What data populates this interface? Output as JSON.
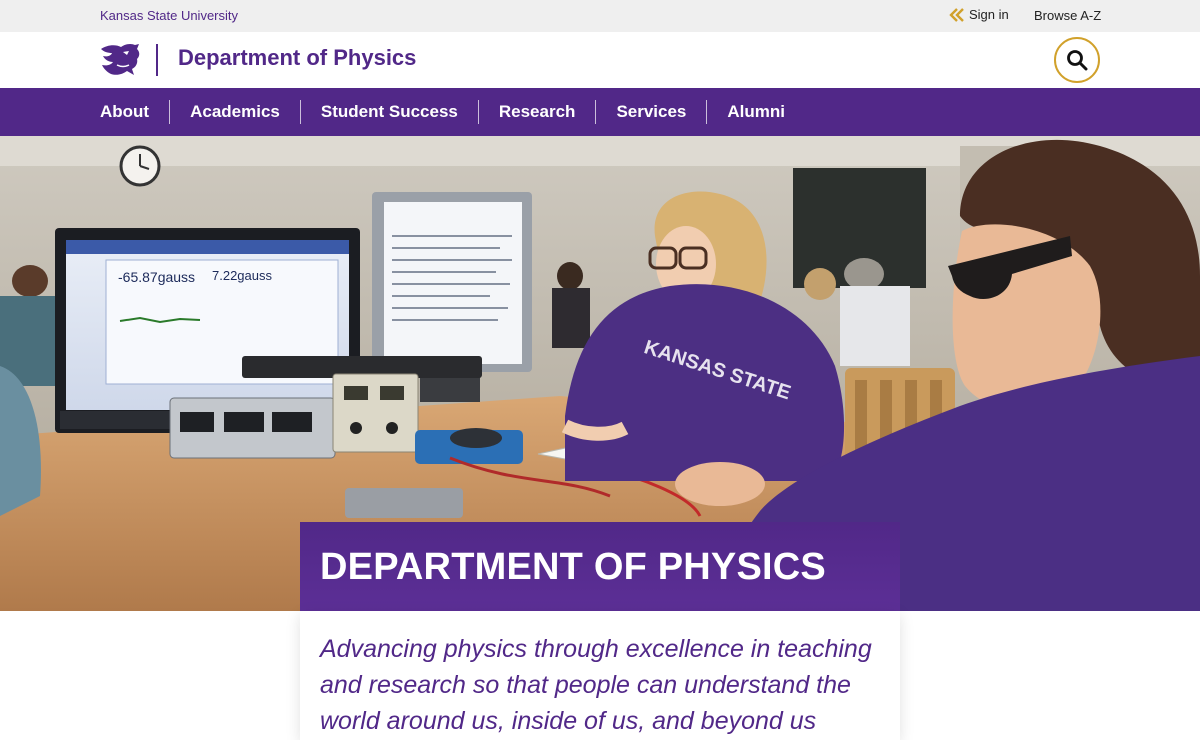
{
  "utility": {
    "university": "Kansas State University",
    "sign_in": "Sign in",
    "browse": "Browse A-Z"
  },
  "brand": {
    "department": "Department of Physics",
    "logo_icon": "powercat-logo-icon",
    "search_icon": "search-icon"
  },
  "nav": {
    "items": [
      {
        "label": "About"
      },
      {
        "label": "Academics"
      },
      {
        "label": "Student Success"
      },
      {
        "label": "Research"
      },
      {
        "label": "Services"
      },
      {
        "label": "Alumni"
      }
    ]
  },
  "hero": {
    "screen_left_reading": "-65.87gauss",
    "screen_right_reading": "7.22gauss",
    "sweatshirt_text": "KANSAS STATE",
    "title": "DEPARTMENT OF PHYSICS",
    "tagline": "Advancing physics through excellence in teaching and research so that people can understand the world around us, inside of us, and beyond us"
  },
  "colors": {
    "purple": "#512888",
    "gold": "#d1a12b",
    "utility_bg": "#efefef"
  }
}
